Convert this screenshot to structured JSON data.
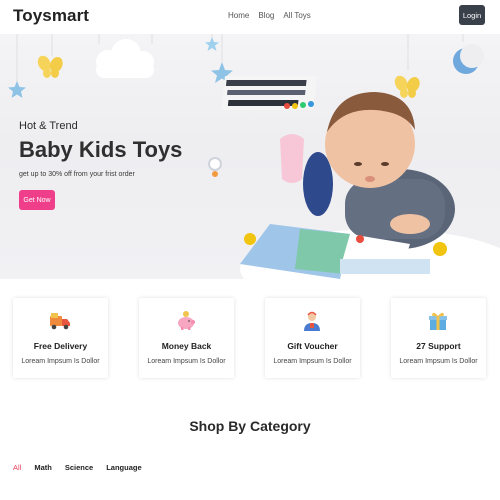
{
  "nav": {
    "brand": "Toysmart",
    "links": [
      "Home",
      "Blog",
      "All Toys"
    ],
    "login_label": "Login"
  },
  "hero": {
    "subtitle": "Hot & Trend",
    "title": "Baby Kids Toys",
    "text": "get up to 30% off from your frist order",
    "button_label": "Get Now"
  },
  "features": [
    {
      "title": "Free Delivery",
      "text": "Loream Impsum Is Dollor",
      "icon": "delivery-truck-icon"
    },
    {
      "title": "Money Back",
      "text": "Loream Impsum Is Dollor",
      "icon": "piggy-bank-icon"
    },
    {
      "title": "Gift Voucher",
      "text": "Loream Impsum Is Dollor",
      "icon": "support-person-icon"
    },
    {
      "title": "27 Support",
      "text": "Loream Impsum Is Dollor",
      "icon": "gift-box-icon"
    }
  ],
  "category_section": {
    "title": "Shop By Category",
    "tabs": [
      "All",
      "Math",
      "Science",
      "Language"
    ],
    "active_tab": "All"
  },
  "colors": {
    "accent": "#ef3f8a",
    "login_bg": "#3a4049",
    "active_tab": "#ef3f5f"
  }
}
